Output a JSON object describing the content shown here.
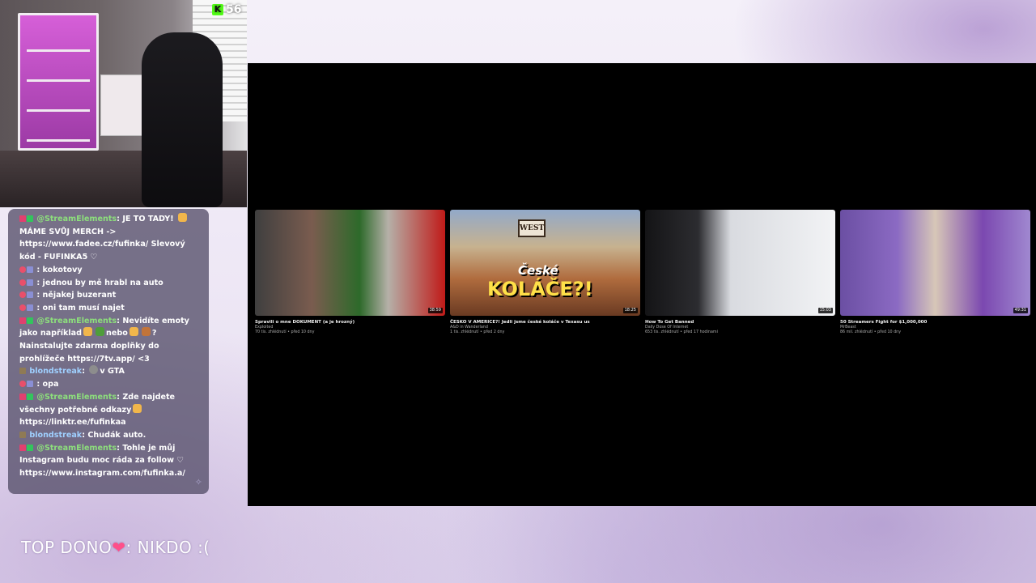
{
  "webcam": {
    "follower_count": "56",
    "platform_icon": "kick-icon"
  },
  "chat": {
    "messages": [
      {
        "badges": [
          "pen-badge",
          "check-badge"
        ],
        "user": "@StreamElements",
        "sep": ": ",
        "text": "JE TO TADY! ",
        "emote": "emote-hand",
        "text2": " MÁME SVŮJ MERCH -> https://www.fadee.cz/fufinka/ Slevový kód - FUFINKA5 ♡"
      },
      {
        "badges": [
          "heart-badge",
          "mod-badge"
        ],
        "user": "",
        "sep": ": ",
        "text": "kokotovy"
      },
      {
        "badges": [
          "heart-badge",
          "mod-badge"
        ],
        "user": "",
        "sep": ": ",
        "text": "jednou by mě hrabl na auto"
      },
      {
        "badges": [
          "heart-badge",
          "mod-badge"
        ],
        "user": "",
        "sep": ": ",
        "text": "nějakej buzerant"
      },
      {
        "badges": [
          "heart-badge",
          "mod-badge"
        ],
        "user": "",
        "sep": ": ",
        "text": "oni tam musí najet"
      },
      {
        "badges": [
          "pen-badge",
          "check-badge"
        ],
        "user": "@StreamElements",
        "sep": ": ",
        "text": "Nevidíte emoty jako například",
        "text2": "nebo",
        "text3": "? Nainstalujte zdarma doplňky do prohlížeče https://7tv.app/ <3"
      },
      {
        "badges": [
          "sub-badge"
        ],
        "user": "blondstreak",
        "sep": ": ",
        "text": "v GTA"
      },
      {
        "badges": [
          "heart-badge",
          "mod-badge"
        ],
        "user": "",
        "sep": ": ",
        "text": "opa"
      },
      {
        "badges": [
          "pen-badge",
          "check-badge"
        ],
        "user": "@StreamElements",
        "sep": ": ",
        "text": "Zde najdete všechny potřebné odkazy",
        "text2": " https://linktr.ee/fufinkaa"
      },
      {
        "badges": [
          "sub-badge"
        ],
        "user": "blondstreak",
        "sep": ": ",
        "text": "Chudák auto."
      },
      {
        "badges": [
          "pen-badge",
          "check-badge"
        ],
        "user": "@StreamElements",
        "sep": ": ",
        "text": "Tohle je můj Instagram budu moc ráda za follow ♡ https://www.instagram.com/fufinka.a/"
      }
    ],
    "corner_icon": "sparkle-icon"
  },
  "player": {
    "videos": [
      {
        "title": "Spravili o mne DOKUMENT (a je hrozný)",
        "channel": "Exploited",
        "meta": "70 tis. zhlédnutí • před 10 dny",
        "duration": "38:59"
      },
      {
        "title": "ČESKO V AMERICE?! Jedli jsme české koláče v Texasu us",
        "channel": "A&D in Wanderland",
        "meta": "1 tis. zhlédnutí • před 2 dny",
        "duration": "18:25",
        "thumb_sign": "WEST",
        "thumb_line1": "České",
        "thumb_line2": "KOLÁČE?!"
      },
      {
        "title": "How To Get Banned",
        "channel": "Daily Dose Of Internet",
        "meta": "653 tis. zhlédnutí • před 17 hodinami",
        "duration": "15:03"
      },
      {
        "title": "50 Streamers Fight for $1,000,000",
        "channel": "MrBeast",
        "meta": "86 mil. zhlédnutí • před 10 dny",
        "duration": "49:31"
      }
    ]
  },
  "top_dono": {
    "label": "TOP DONO",
    "icon": "heart-icon",
    "value": ": NIKDO :("
  },
  "colors": {
    "bot_name": "#8de07c",
    "user_name": "#7fb2ff",
    "chat_bg": "#554e69",
    "player_bg": "#000000"
  }
}
